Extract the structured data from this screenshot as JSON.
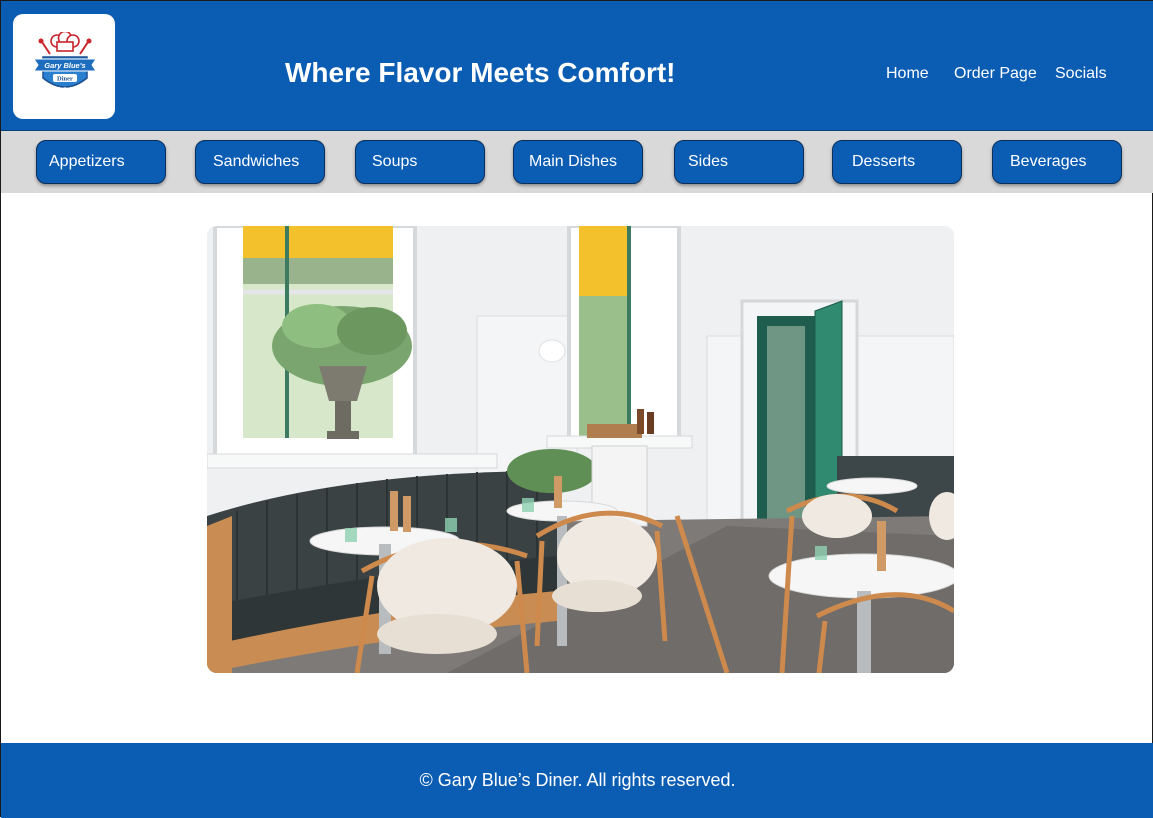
{
  "header": {
    "logo_text_top": "Gary Blue's",
    "logo_text_bottom": "Diner",
    "title": "Where Flavor Meets Comfort!",
    "nav": [
      {
        "label": "Home"
      },
      {
        "label": "Order Page"
      },
      {
        "label": "Socials"
      }
    ]
  },
  "categories": [
    {
      "label": "Appetizers"
    },
    {
      "label": "Sandwiches"
    },
    {
      "label": "Soups"
    },
    {
      "label": "Main Dishes"
    },
    {
      "label": "Sides"
    },
    {
      "label": "Desserts"
    },
    {
      "label": "Beverages"
    }
  ],
  "footer": {
    "copyright": "© Gary Blue’s Diner. All rights reserved."
  },
  "colors": {
    "brand_blue": "#0b5cb3",
    "category_bar": "#d9d9d9"
  }
}
